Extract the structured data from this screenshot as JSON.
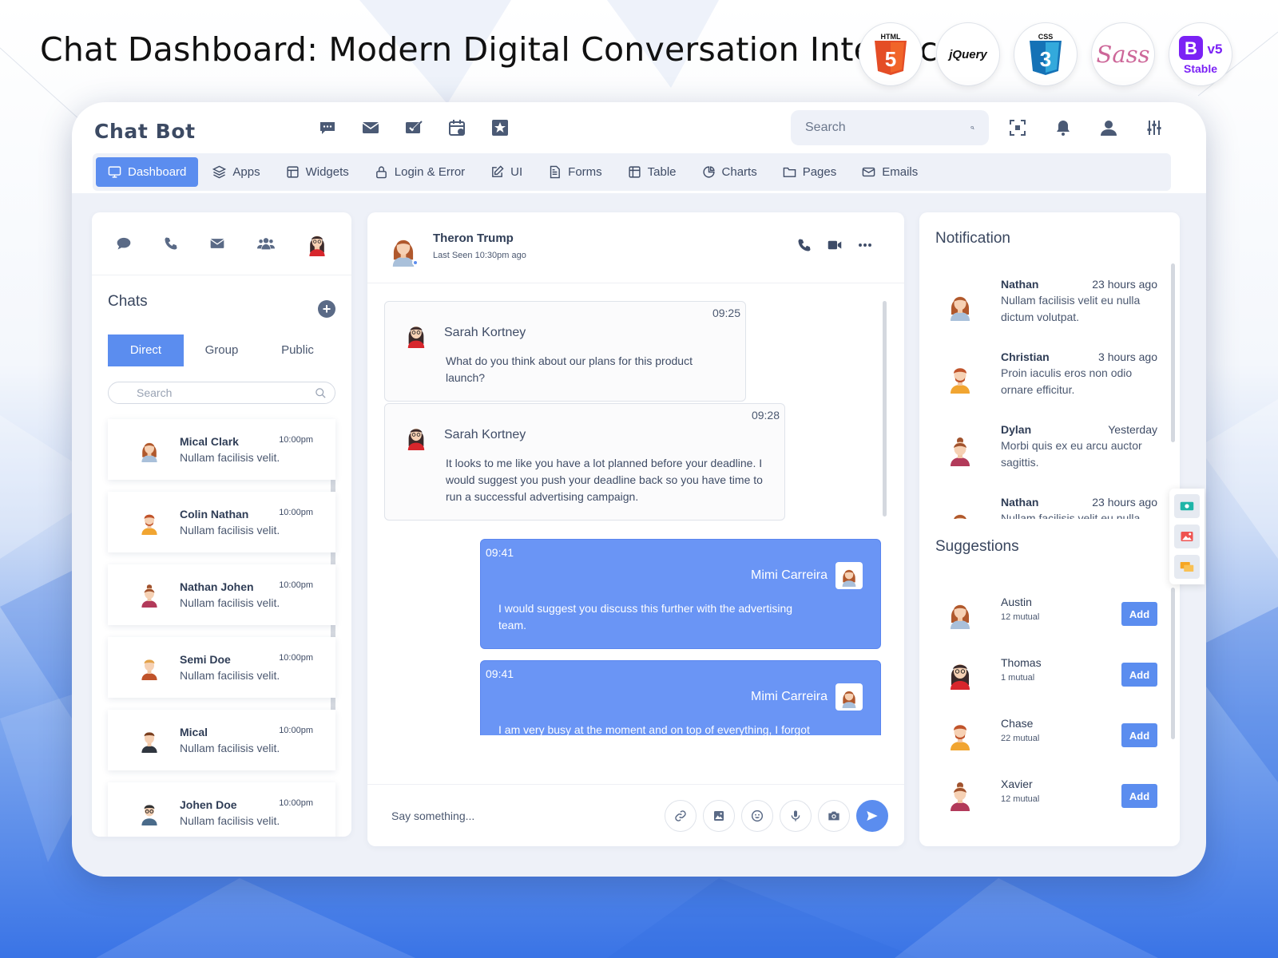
{
  "banner": {
    "title": "Chat Dashboard: Modern Digital Conversation Interface",
    "badges": {
      "html_text": "HTML",
      "html_num": "5",
      "jquery_text": "jQuery",
      "css_text": "CSS",
      "css_num": "3",
      "sass_text": "Sass",
      "bootstrap_letter": "B",
      "bootstrap_version": "v5",
      "bootstrap_stable": "Stable"
    }
  },
  "app": {
    "logo": "Chat Bot"
  },
  "search": {
    "placeholder": "Search"
  },
  "nav": {
    "items": [
      {
        "label": "Dashboard"
      },
      {
        "label": "Apps"
      },
      {
        "label": "Widgets"
      },
      {
        "label": "Login & Error"
      },
      {
        "label": "UI"
      },
      {
        "label": "Forms"
      },
      {
        "label": "Table"
      },
      {
        "label": "Charts"
      },
      {
        "label": "Pages"
      },
      {
        "label": "Emails"
      }
    ]
  },
  "chats": {
    "title": "Chats",
    "segments": [
      "Direct",
      "Group",
      "Public"
    ],
    "search_placeholder": "Search",
    "items": [
      {
        "name": "Mical Clark",
        "time": "10:00pm",
        "message": "Nullam facilisis velit."
      },
      {
        "name": "Colin Nathan",
        "time": "10:00pm",
        "message": "Nullam facilisis velit."
      },
      {
        "name": "Nathan Johen",
        "time": "10:00pm",
        "message": "Nullam facilisis velit."
      },
      {
        "name": "Semi Doe",
        "time": "10:00pm",
        "message": "Nullam facilisis velit."
      },
      {
        "name": "Mical",
        "time": "10:00pm",
        "message": "Nullam facilisis velit."
      },
      {
        "name": "Johen Doe",
        "time": "10:00pm",
        "message": "Nullam facilisis velit."
      }
    ]
  },
  "conversation": {
    "contact_name": "Theron Trump",
    "last_seen": "Last Seen 10:30pm ago",
    "messages": [
      {
        "time": "09:25",
        "sender": "Sarah Kortney",
        "text": "What do you think about our plans for this product launch?"
      },
      {
        "time": "09:28",
        "sender": "Sarah Kortney",
        "text": "It looks to me like you have a lot planned before your deadline. I would suggest you push your deadline back so you have time to run a successful advertising campaign."
      },
      {
        "time": "09:41",
        "sender": "Mimi Carreira",
        "text": "I would suggest you discuss this further with the advertising team."
      },
      {
        "time": "09:41",
        "sender": "Mimi Carreira",
        "text": "I am very busy at the moment and on top of everything, I forgot"
      }
    ],
    "composer_placeholder": "Say something..."
  },
  "notifications": {
    "title": "Notification",
    "items": [
      {
        "name": "Nathan",
        "time": "23 hours ago",
        "text": "Nullam facilisis velit eu nulla dictum volutpat."
      },
      {
        "name": "Christian",
        "time": "3 hours ago",
        "text": "Proin iaculis eros non odio ornare efficitur."
      },
      {
        "name": "Dylan",
        "time": "Yesterday",
        "text": "Morbi quis ex eu arcu auctor sagittis."
      },
      {
        "name": "Nathan",
        "time": "23 hours ago",
        "text": "Nullam facilisis velit eu nulla"
      }
    ]
  },
  "suggestions": {
    "title": "Suggestions",
    "add_label": "Add",
    "items": [
      {
        "name": "Austin",
        "mutual": "12 mutual"
      },
      {
        "name": "Thomas",
        "mutual": "1 mutual"
      },
      {
        "name": "Chase",
        "mutual": "22 mutual"
      },
      {
        "name": "Xavier",
        "mutual": "12 mutual"
      }
    ]
  },
  "colors": {
    "accent": "#5b8def",
    "outgoing_bubble": "#6a95f5",
    "text_dark": "#2f3d56",
    "frame_bg": "#eef1f8"
  },
  "icons": {
    "top": [
      "chat-icon",
      "mail-icon",
      "mail-check-icon",
      "calendar-icon",
      "star-icon"
    ],
    "right": [
      "fullscreen-icon",
      "bell-icon",
      "user-icon",
      "sliders-icon"
    ],
    "left_tabs": [
      "chat-icon",
      "phone-icon",
      "mail-icon",
      "group-icon",
      "profile-avatar"
    ],
    "conversation_actions": [
      "phone-icon",
      "video-icon",
      "more-icon"
    ],
    "composer": [
      "link-icon",
      "image-icon",
      "emoji-icon",
      "mic-icon",
      "camera-icon",
      "send-icon"
    ]
  }
}
